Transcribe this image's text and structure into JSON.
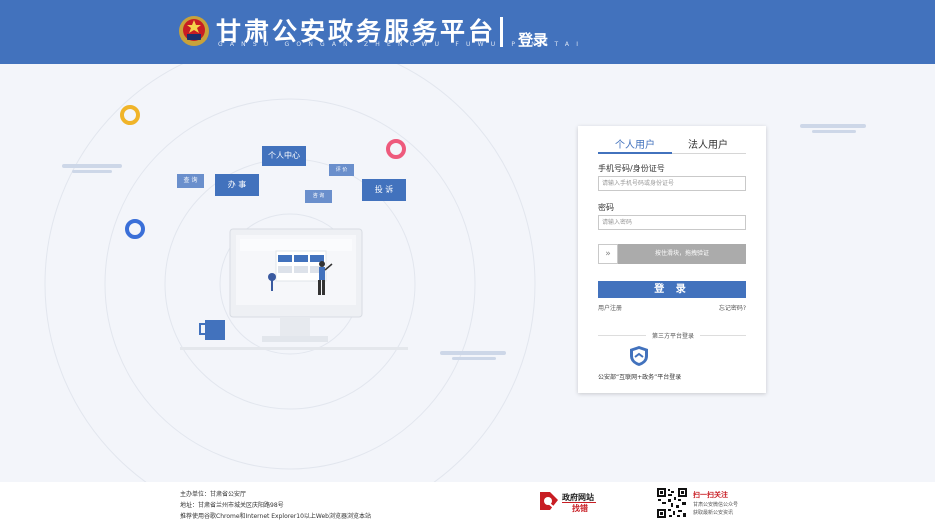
{
  "header": {
    "title": "甘肃公安政务服务平台",
    "pinyin": "GANSU GONGAN ZHENGWU FUWU PINGTAI",
    "page_label": "登录"
  },
  "illustration": {
    "tags": {
      "personal_center": "个人中心",
      "handle": "办 事",
      "query": "查 询",
      "evaluate": "评 价",
      "consult": "咨 询",
      "complain": "投 诉"
    }
  },
  "login": {
    "tabs": [
      {
        "label": "个人用户",
        "active": true
      },
      {
        "label": "法人用户",
        "active": false
      }
    ],
    "account_label": "手机号码/身份证号",
    "account_placeholder": "请输入手机号码或身份证号",
    "password_label": "密码",
    "password_placeholder": "请输入密码",
    "slider_handle": "»",
    "slider_text": "按住滑块，拖拽验证",
    "login_button": "登 录",
    "register_link": "用户注册",
    "forgot_link": "忘记密码?",
    "third_party_label": "第三方平台登录",
    "mps_login": "公安部“互联网+政务”平台登录"
  },
  "footer": {
    "sponsor": "主办单位：甘肃省公安厅",
    "address": "地址：甘肃省兰州市城关区庆阳路98号",
    "browser": "推荐使用谷歌Chrome和Internet Explorer10以上Web浏览器浏览本站",
    "gov_site": "政府网站",
    "gov_error": "找错",
    "qr_title": "扫一扫关注",
    "qr_line1": "甘肃公安微信公众号",
    "qr_line2": "获取最新公安资讯"
  },
  "colors": {
    "brand_blue": "#4272bd",
    "accent_red": "#c81d23"
  }
}
